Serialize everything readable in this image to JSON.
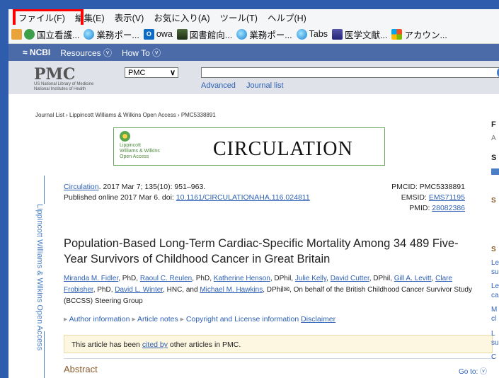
{
  "menubar": {
    "file": "ファイル(F)",
    "edit": "編集(E)",
    "view": "表示(V)",
    "favorites": "お気に入り(A)",
    "tools": "ツール(T)",
    "help": "ヘルプ(H)"
  },
  "favorites": [
    {
      "label": "国立看護...",
      "icon": "green"
    },
    {
      "label": "業務ポー...",
      "icon": "ie"
    },
    {
      "label": "owa",
      "icon": "ol"
    },
    {
      "label": "図書館向...",
      "icon": "book"
    },
    {
      "label": "業務ポー...",
      "icon": "ie"
    },
    {
      "label": "Tabs",
      "icon": "ie"
    },
    {
      "label": "医学文献...",
      "icon": "med"
    },
    {
      "label": "アカウン...",
      "icon": "ms"
    }
  ],
  "ncbi": {
    "logo": "NCBI",
    "resources": "Resources ⓥ",
    "howto": "How To ⓥ"
  },
  "pmc": {
    "logo": "PMC",
    "sub1": "US National Library of Medicine",
    "sub2": "National Institutes of Health",
    "db_value": "PMC",
    "advanced": "Advanced",
    "journal_list": "Journal list"
  },
  "article": {
    "breadcrumb": "Journal List › Lippincott Williams & Wilkins Open Access › PMC5338891",
    "banner": {
      "lww": "Lippincott\nWilliams & Wilkins\nOpen Access",
      "journal": "CIRCULATION"
    },
    "side_text": "Lippincott Williams & Wilkins Open Access",
    "journal_link": "Circulation",
    "citation": ". 2017 Mar 7; 135(10): 951–963.",
    "published": "Published online 2017 Mar 6. doi: ",
    "doi": "10.1161/CIRCULATIONAHA.116.024811",
    "pmcid": "PMCID: PMC5338891",
    "emsid_label": "EMSID: ",
    "emsid": "EMS71195",
    "pmid_label": "PMID: ",
    "pmid": "28082386",
    "title": "Population-Based Long-Term Cardiac-Specific Mortality Among 34 489 Five-Year Survivors of Childhood Cancer in Great Britain",
    "authors": [
      {
        "name": "Miranda M. Fidler",
        "suffix": ", PhD, "
      },
      {
        "name": "Raoul C. Reulen",
        "suffix": ", PhD, "
      },
      {
        "name": "Katherine Henson",
        "suffix": ", DPhil, "
      },
      {
        "name": "Julie Kelly",
        "suffix": ", "
      },
      {
        "name": "David Cutter",
        "suffix": ", DPhil, "
      },
      {
        "name": "Gill A. Levitt",
        "suffix": ", "
      },
      {
        "name": "Clare Frobisher",
        "suffix": ", PhD, "
      },
      {
        "name": "David L. Winter",
        "suffix": ", HNC, and "
      },
      {
        "name": "Michael M. Hawkins",
        "suffix": ", DPhil✉, On behalf of the British Childhood Cancer Survivor Study (BCCSS) Steering Group"
      }
    ],
    "info_author": "Author information",
    "info_notes": "Article notes",
    "info_copyright": "Copyright and License information",
    "disclaimer": "Disclaimer",
    "notice_pre": "This article has been ",
    "notice_link": "cited by",
    "notice_post": " other articles in PMC.",
    "abstract": "Abstract",
    "goto": "Go to: ⓥ"
  },
  "sidebar_right": [
    "F",
    "A",
    "S",
    "S",
    "S",
    "Le",
    "su",
    "Le",
    "ca",
    "M",
    "cl",
    "L",
    "su",
    "C"
  ]
}
